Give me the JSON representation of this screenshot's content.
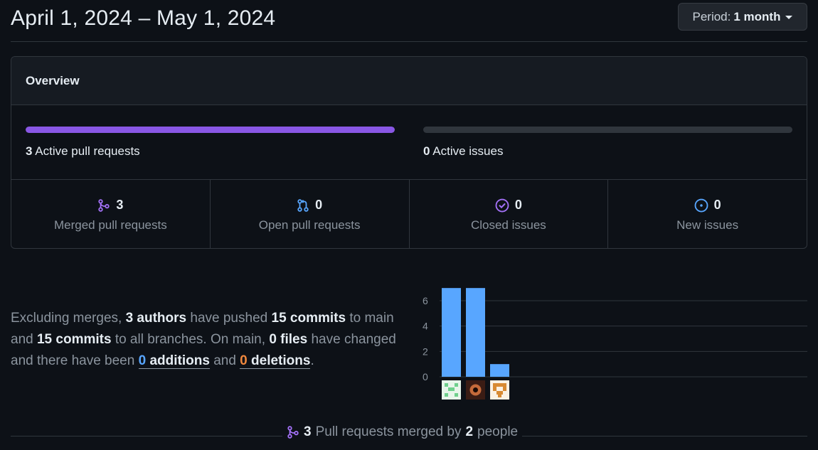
{
  "header": {
    "title": "April 1, 2024 – May 1, 2024",
    "period_label": "Period:",
    "period_value": "1 month"
  },
  "overview": {
    "title": "Overview",
    "pull_requests": {
      "count": "3",
      "label": "Active pull requests",
      "fill_fraction": 1.0,
      "color": "#8957e5"
    },
    "issues": {
      "count": "0",
      "label": "Active issues",
      "fill_fraction": 0.0,
      "color": "#30363d"
    },
    "stats": [
      {
        "icon": "merged-pr-icon",
        "value": "3",
        "label": "Merged pull requests",
        "color": "#a371f7"
      },
      {
        "icon": "open-pr-icon",
        "value": "0",
        "label": "Open pull requests",
        "color": "#58a6ff"
      },
      {
        "icon": "closed-issue-icon",
        "value": "0",
        "label": "Closed issues",
        "color": "#a371f7"
      },
      {
        "icon": "new-issue-icon",
        "value": "0",
        "label": "New issues",
        "color": "#58a6ff"
      }
    ]
  },
  "summary": {
    "p1": "Excluding merges,",
    "authors": "3 authors",
    "p2": "have pushed",
    "commits_main": "15 commits",
    "p3": "to main and",
    "commits_all": "15 commits",
    "p4": "to all branches. On main,",
    "files": "0 files",
    "p5": "have changed and there have been",
    "additions_num": "0",
    "additions_word": "additions",
    "p6": "and",
    "deletions_num": "0",
    "deletions_word": "deletions",
    "p7": "."
  },
  "chart_data": {
    "type": "bar",
    "categories": [
      "author-1",
      "author-2",
      "author-3"
    ],
    "values": [
      7,
      7,
      1
    ],
    "yticks": [
      0,
      2,
      4,
      6
    ],
    "ylim": [
      0,
      6
    ],
    "bar_color": "#58a6ff",
    "avatar_icons": [
      "avatar-green-identicon",
      "avatar-eye-photo",
      "avatar-orange-identicon"
    ]
  },
  "footer": {
    "count": "3",
    "text1": "Pull requests merged by",
    "people": "2",
    "text2": "people"
  }
}
